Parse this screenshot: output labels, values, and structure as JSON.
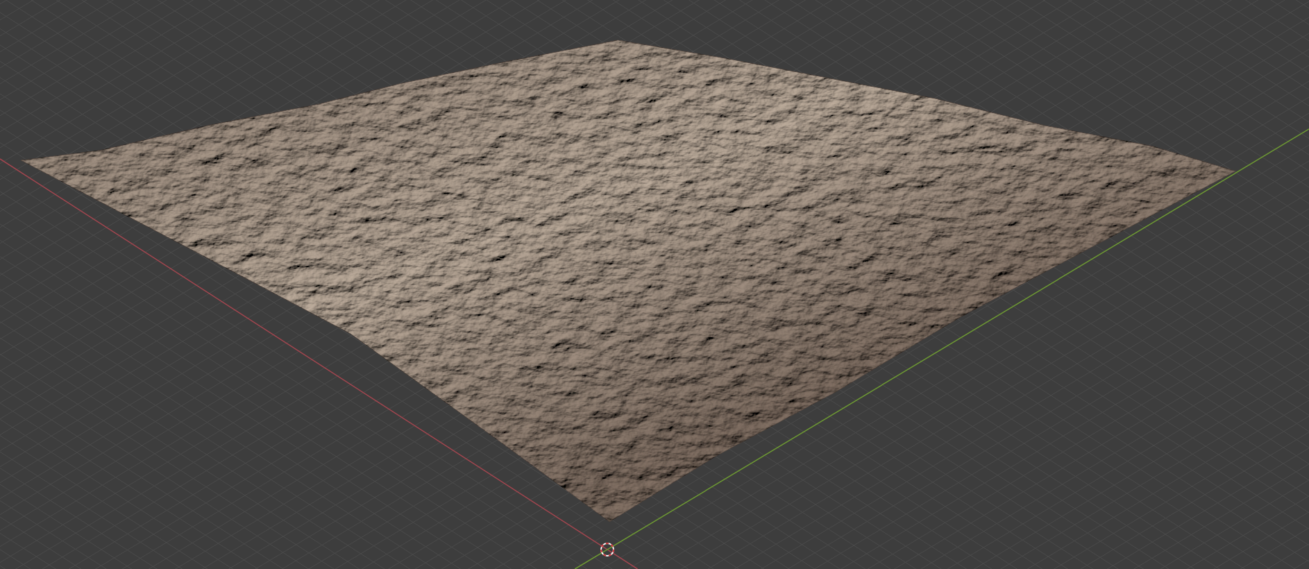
{
  "viewport": {
    "grid": true,
    "axes": [
      {
        "color": "#a2464f"
      },
      {
        "color": "#6e9a33"
      }
    ],
    "cursor": true
  }
}
